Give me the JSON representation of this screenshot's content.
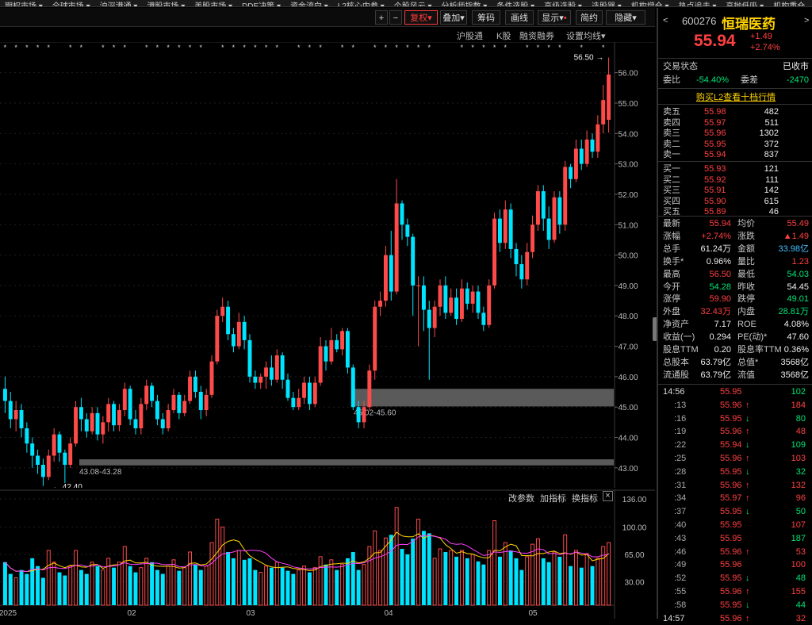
{
  "topbar": {
    "items": [
      "期权市场",
      "全球市场",
      "沪深港通",
      "港股市场",
      "美股市场",
      "DDE决策",
      "资金流向",
      "L2核心内参",
      "个股风云",
      "分析师指数",
      "条件选股",
      "高级选股",
      "选股器",
      "机构增仓",
      "热点追击",
      "高抛低吸",
      "机构重仓"
    ]
  },
  "toolbar": {
    "plus": "+",
    "minus": "−",
    "dropdown": "▾",
    "adjust": "复权",
    "overlay": "叠加",
    "chips": "筹码",
    "draw": "画线",
    "display": "显示",
    "brief": "简约",
    "hide": "隐藏"
  },
  "subbar": {
    "items": [
      "沪股通",
      "K股",
      "融资融券",
      "设置均线"
    ]
  },
  "stock": {
    "code": "600276",
    "name": "恒瑞医药",
    "price": "55.94",
    "change": "+1.49",
    "change_pct": "+2.74%"
  },
  "status": {
    "label": "交易状态",
    "value": "已收市",
    "webi_label": "委比",
    "webi_value": "-54.40%",
    "weicha_label": "委差",
    "weicha_value": "-2470",
    "l2_link": "购买L2查看十档行情"
  },
  "asks": [
    {
      "label": "卖五",
      "price": "55.98",
      "vol": "482"
    },
    {
      "label": "卖四",
      "price": "55.97",
      "vol": "511"
    },
    {
      "label": "卖三",
      "price": "55.96",
      "vol": "1302"
    },
    {
      "label": "卖二",
      "price": "55.95",
      "vol": "372"
    },
    {
      "label": "卖一",
      "price": "55.94",
      "vol": "837"
    }
  ],
  "bids": [
    {
      "label": "买一",
      "price": "55.93",
      "vol": "121"
    },
    {
      "label": "买二",
      "price": "55.92",
      "vol": "111"
    },
    {
      "label": "买三",
      "price": "55.91",
      "vol": "142"
    },
    {
      "label": "买四",
      "price": "55.90",
      "vol": "615"
    },
    {
      "label": "买五",
      "price": "55.89",
      "vol": "46"
    }
  ],
  "quote": [
    {
      "l1": "最新",
      "v1": "55.94",
      "c1": "red",
      "l2": "均价",
      "v2": "55.49",
      "c2": "red"
    },
    {
      "l1": "涨幅",
      "v1": "+2.74%",
      "c1": "red",
      "l2": "涨跌",
      "v2": "▲1.49",
      "c2": "red"
    },
    {
      "l1": "总手",
      "v1": "61.24万",
      "c1": "white",
      "l2": "金额",
      "v2": "33.98亿",
      "c2": "cyan"
    },
    {
      "l1": "换手*",
      "v1": "0.96%",
      "c1": "white",
      "l2": "量比",
      "v2": "1.23",
      "c2": "red"
    },
    {
      "l1": "最高",
      "v1": "56.50",
      "c1": "red",
      "l2": "最低",
      "v2": "54.03",
      "c2": "green"
    },
    {
      "l1": "今开",
      "v1": "54.28",
      "c1": "green",
      "l2": "昨收",
      "v2": "54.45",
      "c2": "white"
    },
    {
      "l1": "涨停",
      "v1": "59.90",
      "c1": "red",
      "l2": "跌停",
      "v2": "49.01",
      "c2": "green"
    },
    {
      "l1": "外盘",
      "v1": "32.43万",
      "c1": "red",
      "l2": "内盘",
      "v2": "28.81万",
      "c2": "green"
    },
    {
      "l1": "净资产",
      "v1": "7.17",
      "c1": "white",
      "l2": "ROE",
      "v2": "4.08%",
      "c2": "white"
    },
    {
      "l1": "收益(一)",
      "v1": "0.294",
      "c1": "white",
      "l2": "PE(动)*",
      "v2": "47.60",
      "c2": "white"
    },
    {
      "l1": "股息TTM",
      "v1": "0.20",
      "c1": "white",
      "l2": "股息率TTM",
      "v2": "0.36%",
      "c2": "white"
    },
    {
      "l1": "总股本",
      "v1": "63.79亿",
      "c1": "white",
      "l2": "总值*",
      "v2": "3568亿",
      "c2": "white"
    },
    {
      "l1": "流通股",
      "v1": "63.79亿",
      "c1": "white",
      "l2": "流值",
      "v2": "3568亿",
      "c2": "white"
    }
  ],
  "ticks": [
    {
      "t": "14:56",
      "p": "55.95",
      "pc": "red",
      "arrow": "",
      "v": "102",
      "vc": "green"
    },
    {
      "t": ":13",
      "p": "55.96",
      "pc": "red",
      "arrow": "↑",
      "v": "184",
      "vc": "red"
    },
    {
      "t": ":16",
      "p": "55.95",
      "pc": "red",
      "arrow": "↓",
      "v": "80",
      "vc": "green"
    },
    {
      "t": ":19",
      "p": "55.96",
      "pc": "red",
      "arrow": "↑",
      "v": "48",
      "vc": "red"
    },
    {
      "t": ":22",
      "p": "55.94",
      "pc": "red",
      "arrow": "↓",
      "v": "109",
      "vc": "green"
    },
    {
      "t": ":25",
      "p": "55.96",
      "pc": "red",
      "arrow": "↑",
      "v": "103",
      "vc": "red"
    },
    {
      "t": ":28",
      "p": "55.95",
      "pc": "red",
      "arrow": "↓",
      "v": "32",
      "vc": "green"
    },
    {
      "t": ":31",
      "p": "55.96",
      "pc": "red",
      "arrow": "↑",
      "v": "132",
      "vc": "red"
    },
    {
      "t": ":34",
      "p": "55.97",
      "pc": "red",
      "arrow": "↑",
      "v": "96",
      "vc": "red"
    },
    {
      "t": ":37",
      "p": "55.95",
      "pc": "red",
      "arrow": "↓",
      "v": "50",
      "vc": "green"
    },
    {
      "t": ":40",
      "p": "55.95",
      "pc": "red",
      "arrow": "",
      "v": "107",
      "vc": "red"
    },
    {
      "t": ":43",
      "p": "55.95",
      "pc": "red",
      "arrow": "",
      "v": "187",
      "vc": "green"
    },
    {
      "t": ":46",
      "p": "55.96",
      "pc": "red",
      "arrow": "↑",
      "v": "53",
      "vc": "red"
    },
    {
      "t": ":49",
      "p": "55.96",
      "pc": "red",
      "arrow": "",
      "v": "100",
      "vc": "red"
    },
    {
      "t": ":52",
      "p": "55.95",
      "pc": "red",
      "arrow": "↓",
      "v": "48",
      "vc": "green"
    },
    {
      "t": ":55",
      "p": "55.96",
      "pc": "red",
      "arrow": "↑",
      "v": "155",
      "vc": "red"
    },
    {
      "t": ":58",
      "p": "55.95",
      "pc": "red",
      "arrow": "↓",
      "v": "44",
      "vc": "green"
    },
    {
      "t": "14:57",
      "p": "55.96",
      "pc": "red",
      "arrow": "↑",
      "v": "32",
      "vc": "red"
    }
  ],
  "vol_panel": {
    "btn_params": "改参数",
    "btn_add": "加指标",
    "btn_swap": "换指标",
    "close": "×"
  },
  "chart_data": {
    "type": "candlestick",
    "price_axis": [
      "56.00",
      "55.00",
      "54.00",
      "53.00",
      "52.00",
      "51.00",
      "50.00",
      "49.00",
      "48.00",
      "47.00",
      "46.00",
      "45.00",
      "44.00",
      "43.00"
    ],
    "ylim": [
      42.5,
      56.8
    ],
    "vol_axis": [
      "136.00",
      "100.00",
      "65.00",
      "30.00"
    ],
    "vol_ylim": [
      0,
      140
    ],
    "x_labels": [
      "2025",
      "02",
      "03",
      "04",
      "05"
    ],
    "annotations": {
      "high": "56.50",
      "low": "42.40",
      "band1": "43.08-43.28",
      "band2": "45.02-45.60"
    },
    "bands": [
      [
        43.08,
        43.28
      ],
      [
        45.02,
        45.6
      ]
    ],
    "candles": [
      [
        45.6,
        45.2,
        46.0,
        44.8
      ],
      [
        45.2,
        44.6,
        45.5,
        44.3
      ],
      [
        44.6,
        44.9,
        45.2,
        44.2
      ],
      [
        44.9,
        44.3,
        45.1,
        44.0
      ],
      [
        44.3,
        43.8,
        44.5,
        43.5
      ],
      [
        43.8,
        43.4,
        44.0,
        43.0
      ],
      [
        43.4,
        43.1,
        43.6,
        42.8
      ],
      [
        43.1,
        42.7,
        43.3,
        42.4
      ],
      [
        42.7,
        43.4,
        43.6,
        42.6
      ],
      [
        43.4,
        44.1,
        44.3,
        43.2
      ],
      [
        44.1,
        43.5,
        44.2,
        43.2
      ],
      [
        43.5,
        43.1,
        43.6,
        42.5
      ],
      [
        43.1,
        43.8,
        44.0,
        43.0
      ],
      [
        43.8,
        45.0,
        45.2,
        43.7
      ],
      [
        45.0,
        44.6,
        45.3,
        44.2
      ],
      [
        44.6,
        44.2,
        44.8,
        44.0
      ],
      [
        44.2,
        44.8,
        45.0,
        44.1
      ],
      [
        44.8,
        44.1,
        45.0,
        43.9
      ],
      [
        44.1,
        44.5,
        44.7,
        43.8
      ],
      [
        44.5,
        45.1,
        45.3,
        44.2
      ],
      [
        45.1,
        44.4,
        45.2,
        44.2
      ],
      [
        44.4,
        44.9,
        45.1,
        44.2
      ],
      [
        44.9,
        45.6,
        45.8,
        44.7
      ],
      [
        45.6,
        44.6,
        45.7,
        44.4
      ],
      [
        44.6,
        44.3,
        44.9,
        44.1
      ],
      [
        44.3,
        45.1,
        45.3,
        44.1
      ],
      [
        45.1,
        45.7,
        45.9,
        44.9
      ],
      [
        45.7,
        45.2,
        45.8,
        45.0
      ],
      [
        45.2,
        44.6,
        45.4,
        44.4
      ],
      [
        44.6,
        44.3,
        44.8,
        44.1
      ],
      [
        44.3,
        44.9,
        45.1,
        44.2
      ],
      [
        44.9,
        45.4,
        45.6,
        44.8
      ],
      [
        45.4,
        44.8,
        45.5,
        44.6
      ],
      [
        44.8,
        45.2,
        45.4,
        44.7
      ],
      [
        45.2,
        46.0,
        46.2,
        45.1
      ],
      [
        46.0,
        45.5,
        46.2,
        45.3
      ],
      [
        45.5,
        44.9,
        45.7,
        44.6
      ],
      [
        44.9,
        45.4,
        45.6,
        44.7
      ],
      [
        45.4,
        46.5,
        46.7,
        45.3
      ],
      [
        46.5,
        48.0,
        48.2,
        46.4
      ],
      [
        48.0,
        48.3,
        48.6,
        47.8
      ],
      [
        48.3,
        47.4,
        48.5,
        47.2
      ],
      [
        47.4,
        47.0,
        47.6,
        46.8
      ],
      [
        47.0,
        47.8,
        48.1,
        46.9
      ],
      [
        47.8,
        47.2,
        48.0,
        46.9
      ],
      [
        47.2,
        46.0,
        47.4,
        45.8
      ],
      [
        46.0,
        45.8,
        46.2,
        45.6
      ],
      [
        45.8,
        46.0,
        46.1,
        45.6
      ],
      [
        46.0,
        46.3,
        46.5,
        45.6
      ],
      [
        46.3,
        45.9,
        46.7,
        45.7
      ],
      [
        45.9,
        46.7,
        46.9,
        45.8
      ],
      [
        46.7,
        45.9,
        46.8,
        45.6
      ],
      [
        45.9,
        45.3,
        46.1,
        45.2
      ],
      [
        45.3,
        45.0,
        45.5,
        44.9
      ],
      [
        45.0,
        45.3,
        45.6,
        44.9
      ],
      [
        45.3,
        45.8,
        46.0,
        45.1
      ],
      [
        45.8,
        45.1,
        46.0,
        44.9
      ],
      [
        45.1,
        45.8,
        46.0,
        45.0
      ],
      [
        45.8,
        47.0,
        47.3,
        45.7
      ],
      [
        47.0,
        46.5,
        47.2,
        46.2
      ],
      [
        46.5,
        47.2,
        47.6,
        46.4
      ],
      [
        47.2,
        46.9,
        47.4,
        46.8
      ],
      [
        46.9,
        47.5,
        47.6,
        46.7
      ],
      [
        47.5,
        46.3,
        47.6,
        46.1
      ],
      [
        46.3,
        45.0,
        46.4,
        44.9
      ],
      [
        45.0,
        44.5,
        45.2,
        44.3
      ],
      [
        44.5,
        45.0,
        45.2,
        44.3
      ],
      [
        45.0,
        46.2,
        46.4,
        44.9
      ],
      [
        46.2,
        48.3,
        48.5,
        45.9
      ],
      [
        48.3,
        48.5,
        48.8,
        48.0
      ],
      [
        48.5,
        50.0,
        50.3,
        48.3
      ],
      [
        50.0,
        48.8,
        50.8,
        48.5
      ],
      [
        48.8,
        51.7,
        52.5,
        48.7
      ],
      [
        51.7,
        51.0,
        51.8,
        50.5
      ],
      [
        51.0,
        50.6,
        51.2,
        50.3
      ],
      [
        50.6,
        49.0,
        50.7,
        48.0
      ],
      [
        49.0,
        49.0,
        49.3,
        47.0
      ],
      [
        49.0,
        48.2,
        49.3,
        47.5
      ],
      [
        48.2,
        47.6,
        48.5,
        45.9
      ],
      [
        47.6,
        48.3,
        48.5,
        47.3
      ],
      [
        48.3,
        49.0,
        49.2,
        48.0
      ],
      [
        49.0,
        48.1,
        49.3,
        47.9
      ],
      [
        48.1,
        48.6,
        48.9,
        48.0
      ],
      [
        48.6,
        47.9,
        48.9,
        47.7
      ],
      [
        47.9,
        48.9,
        49.2,
        47.8
      ],
      [
        48.9,
        48.4,
        49.1,
        48.2
      ],
      [
        48.4,
        48.8,
        49.0,
        48.1
      ],
      [
        48.8,
        48.1,
        49.0,
        47.9
      ],
      [
        48.1,
        47.7,
        48.3,
        47.5
      ],
      [
        47.7,
        49.0,
        49.2,
        47.6
      ],
      [
        49.0,
        51.2,
        51.4,
        48.9
      ],
      [
        51.2,
        50.4,
        51.5,
        50.1
      ],
      [
        50.4,
        51.5,
        51.8,
        50.2
      ],
      [
        51.5,
        50.2,
        51.7,
        49.9
      ],
      [
        50.2,
        49.7,
        50.4,
        49.3
      ],
      [
        49.7,
        49.2,
        50.0,
        48.9
      ],
      [
        49.2,
        50.1,
        50.4,
        49.0
      ],
      [
        50.1,
        51.0,
        51.3,
        49.9
      ],
      [
        51.0,
        52.1,
        52.3,
        50.8
      ],
      [
        52.1,
        51.2,
        52.3,
        50.8
      ],
      [
        51.2,
        50.5,
        51.6,
        50.2
      ],
      [
        50.5,
        51.9,
        52.1,
        50.4
      ],
      [
        51.9,
        51.0,
        52.1,
        50.7
      ],
      [
        51.0,
        52.9,
        53.1,
        50.8
      ],
      [
        52.9,
        52.5,
        53.0,
        52.2
      ],
      [
        52.5,
        53.5,
        53.8,
        52.4
      ],
      [
        53.5,
        53.0,
        53.8,
        52.8
      ],
      [
        53.0,
        53.8,
        54.1,
        52.9
      ],
      [
        53.8,
        53.4,
        54.0,
        53.2
      ],
      [
        53.4,
        54.3,
        54.6,
        53.2
      ],
      [
        54.3,
        55.1,
        55.6,
        54.0
      ],
      [
        54.45,
        55.94,
        56.5,
        54.03
      ]
    ],
    "volumes": [
      55,
      40,
      35,
      45,
      40,
      60,
      50,
      35,
      70,
      55,
      42,
      38,
      50,
      70,
      45,
      40,
      55,
      50,
      45,
      60,
      48,
      55,
      75,
      50,
      42,
      48,
      60,
      55,
      45,
      40,
      50,
      58,
      44,
      48,
      68,
      52,
      45,
      50,
      80,
      110,
      100,
      68,
      60,
      70,
      58,
      60,
      45,
      42,
      50,
      48,
      55,
      48,
      44,
      40,
      45,
      50,
      42,
      48,
      62,
      52,
      58,
      45,
      52,
      60,
      68,
      45,
      52,
      75,
      95,
      70,
      86,
      90,
      125,
      72,
      65,
      85,
      110,
      95,
      92,
      60,
      72,
      68,
      70,
      62,
      70,
      60,
      65,
      56,
      52,
      70,
      108,
      62,
      80,
      70,
      60,
      45,
      62,
      78,
      85,
      60,
      55,
      68,
      62,
      90,
      50,
      70,
      48,
      66,
      50,
      60,
      75,
      80
    ]
  }
}
